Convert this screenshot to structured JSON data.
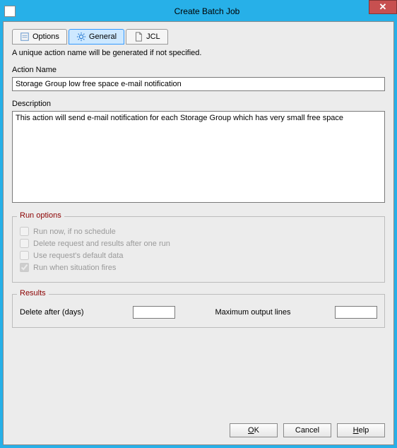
{
  "window": {
    "title": "Create Batch Job"
  },
  "tabs": {
    "options": "Options",
    "general": "General",
    "jcl": "JCL"
  },
  "hint": "A unique action name will be generated if not specified.",
  "actionName": {
    "label": "Action Name",
    "value": "Storage Group low free space e-mail notification"
  },
  "description": {
    "label": "Description",
    "value": "This action will send e-mail notification for each Storage Group which has very small free space"
  },
  "runOptions": {
    "title": "Run options",
    "items": [
      {
        "label": "Run now, if no schedule",
        "checked": false
      },
      {
        "label": "Delete request and results after one run",
        "checked": false
      },
      {
        "label": "Use request's default data",
        "checked": false
      },
      {
        "label": "Run when situation fires",
        "checked": true
      }
    ]
  },
  "results": {
    "title": "Results",
    "deleteAfterLabel": "Delete after (days)",
    "deleteAfterValue": "",
    "maxLinesLabel": "Maximum output lines",
    "maxLinesValue": ""
  },
  "buttons": {
    "ok": "OK",
    "cancel": "Cancel",
    "help": "Help"
  }
}
